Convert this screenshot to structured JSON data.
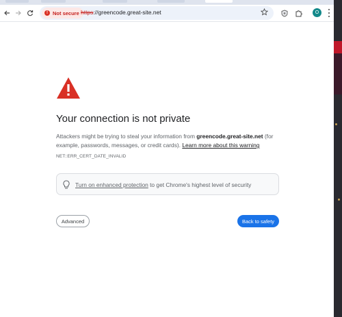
{
  "browser": {
    "security_chip": "Not secure",
    "url_scheme": "https",
    "url_rest": "://greencode.great-site.net",
    "profile_initial": "O"
  },
  "interstitial": {
    "heading": "Your connection is not private",
    "body_prefix": "Attackers might be trying to steal your information from ",
    "body_host": "greencode.great-site.net",
    "body_suffix": " (for example, passwords, messages, or credit cards). ",
    "learn_more_link": "Learn more about this warning",
    "error_code": "NET::ERR_CERT_DATE_INVALID",
    "enhanced_link": "Turn on enhanced protection",
    "enhanced_suffix": " to get Chrome's highest level of security",
    "advanced_button": "Advanced",
    "safety_button": "Back to safety"
  },
  "colors": {
    "warning_red": "#d93025",
    "primary_blue": "#1a73e8",
    "profile_teal": "#13898a"
  },
  "icons": [
    "back-arrow-icon",
    "forward-arrow-icon",
    "reload-icon",
    "star-icon",
    "shield-icon",
    "extensions-icon",
    "lightbulb-icon",
    "warning-triangle-icon"
  ]
}
